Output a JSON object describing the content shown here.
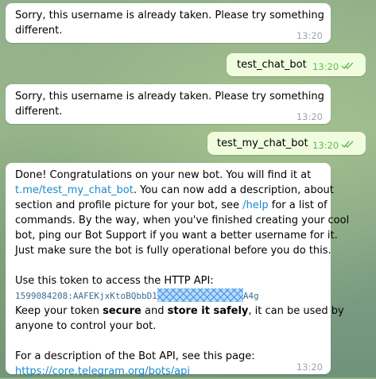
{
  "messages": [
    {
      "text_line1": "Sorry, this username is already taken. Please try something",
      "text_line2": "different.",
      "time": "13:20"
    },
    {
      "text": "test_chat_bot",
      "time": "13:20"
    },
    {
      "text_line1": "Sorry, this username is already taken. Please try something",
      "text_line2": "different.",
      "time": "13:20"
    },
    {
      "text": "test_my_chat_bot",
      "time": "13:20"
    }
  ],
  "bot_reply": {
    "p1_a": "Done! Congratulations on your new bot. You will find it at",
    "bot_link": "t.me/test_my_chat_bot",
    "p1_b": ". You can now add a description, about",
    "p1_c": "section and profile picture for your bot, see",
    "help_link": "/help",
    "p1_d": "for a list of",
    "p1_e": "commands. By the way, when you've finished creating your cool",
    "p1_f": "bot, ping our Bot Support if you want a better username for it.",
    "p1_g": "Just make sure the bot is fully operational before you do this.",
    "token_intro": "Use this token to access the HTTP API:",
    "token_start": "1599084208:AAFEKjxKtoBQbbD1",
    "token_end": "A4g",
    "keep_a": "Keep your token",
    "keep_secure": "secure",
    "keep_and": "and",
    "keep_store": "store it safely",
    "keep_b": ", it can be used by",
    "keep_c": "anyone to control your bot.",
    "api_intro": "For a description of the Bot API, see this page:",
    "api_link": "https://core.telegram.org/bots/api",
    "time": "13:20"
  },
  "colors": {
    "incoming": "#ffffff",
    "outgoing": "#effdde",
    "link": "#168acd",
    "read_check": "#5dba5a"
  }
}
